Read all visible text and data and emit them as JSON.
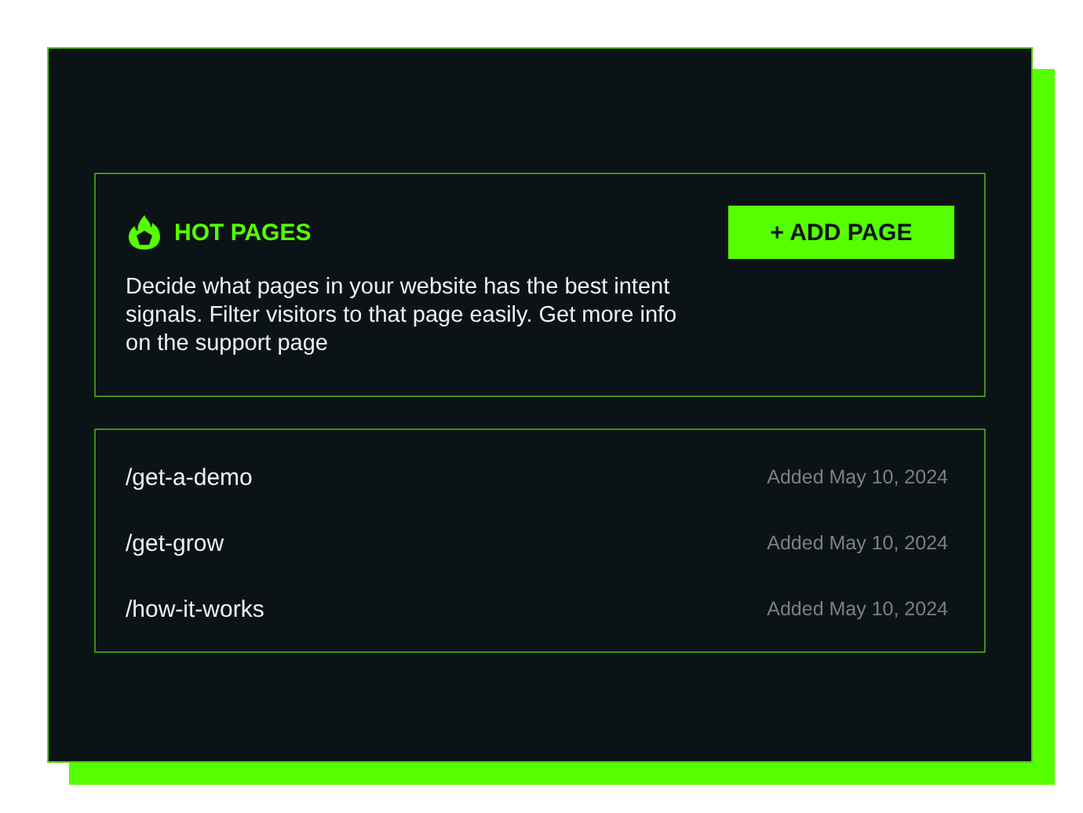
{
  "header": {
    "title": "HOT PAGES",
    "button": "+ ADD PAGE",
    "description": "Decide what pages in your website has the best intent signals. Filter visitors to that page easily. Get more info on the support page"
  },
  "pages": [
    {
      "path": "/get-a-demo",
      "added": "Added May 10, 2024"
    },
    {
      "path": "/get-grow",
      "added": "Added May 10, 2024"
    },
    {
      "path": "/how-it-works",
      "added": "Added May 10, 2024"
    }
  ]
}
